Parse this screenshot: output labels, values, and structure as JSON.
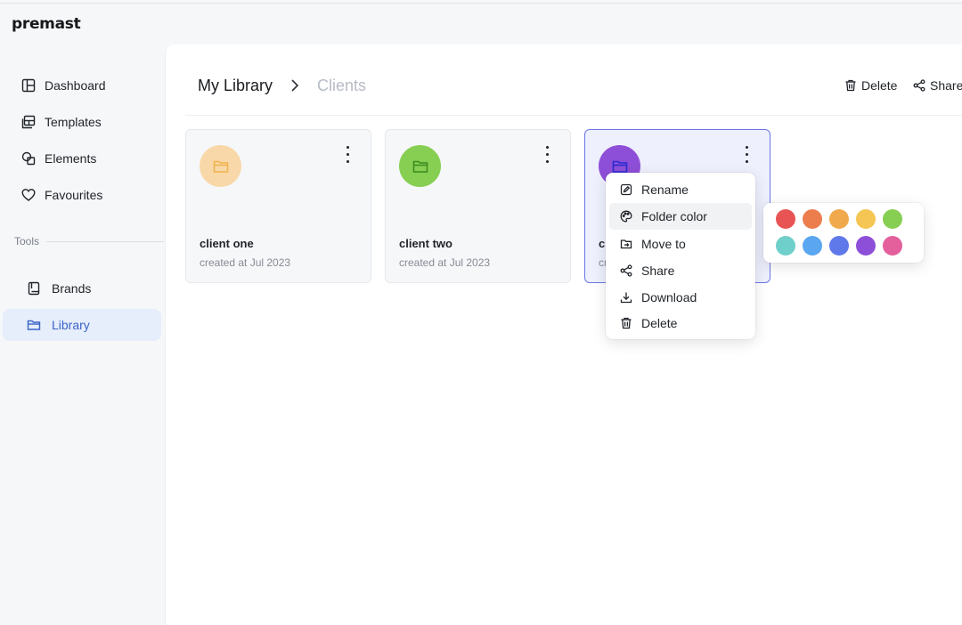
{
  "app": {
    "logo": "premast"
  },
  "sidebar": {
    "items": [
      {
        "label": "Dashboard",
        "icon": "layout-icon"
      },
      {
        "label": "Templates",
        "icon": "templates-icon"
      },
      {
        "label": "Elements",
        "icon": "shapes-icon"
      },
      {
        "label": "Favourites",
        "icon": "heart-icon"
      }
    ],
    "section_label": "Tools",
    "tools": [
      {
        "label": "Brands",
        "icon": "book-icon"
      },
      {
        "label": "Library",
        "icon": "folder-icon",
        "active": true
      }
    ]
  },
  "header": {
    "breadcrumb_root": "My Library",
    "breadcrumb_current": "Clients",
    "delete_label": "Delete",
    "share_label": "Share"
  },
  "folders": [
    {
      "name": "client one",
      "created": "created at Jul 2023",
      "color": "#f8d8a8",
      "icon_color": "#f0b24a"
    },
    {
      "name": "client two",
      "created": "created at Jul 2023",
      "color": "#86cf52",
      "icon_color": "#3a8a1e"
    },
    {
      "name": "cl",
      "created": "cr",
      "color": "#8e4fd8",
      "icon_color": "#2a2bd0",
      "selected": true
    }
  ],
  "context_menu": {
    "items": [
      {
        "label": "Rename",
        "icon": "edit-icon"
      },
      {
        "label": "Folder color",
        "icon": "palette-icon",
        "hover": true
      },
      {
        "label": "Move to",
        "icon": "move-icon"
      },
      {
        "label": "Share",
        "icon": "share-icon"
      },
      {
        "label": "Download",
        "icon": "download-icon"
      },
      {
        "label": "Delete",
        "icon": "trash-icon"
      }
    ]
  },
  "color_palette": {
    "colors": [
      "#e85454",
      "#ec7e4e",
      "#f1a94e",
      "#f5c653",
      "#86cf52",
      "#6fcfcb",
      "#5aa6f0",
      "#5f78ea",
      "#8e4fd8",
      "#e3609d"
    ]
  }
}
